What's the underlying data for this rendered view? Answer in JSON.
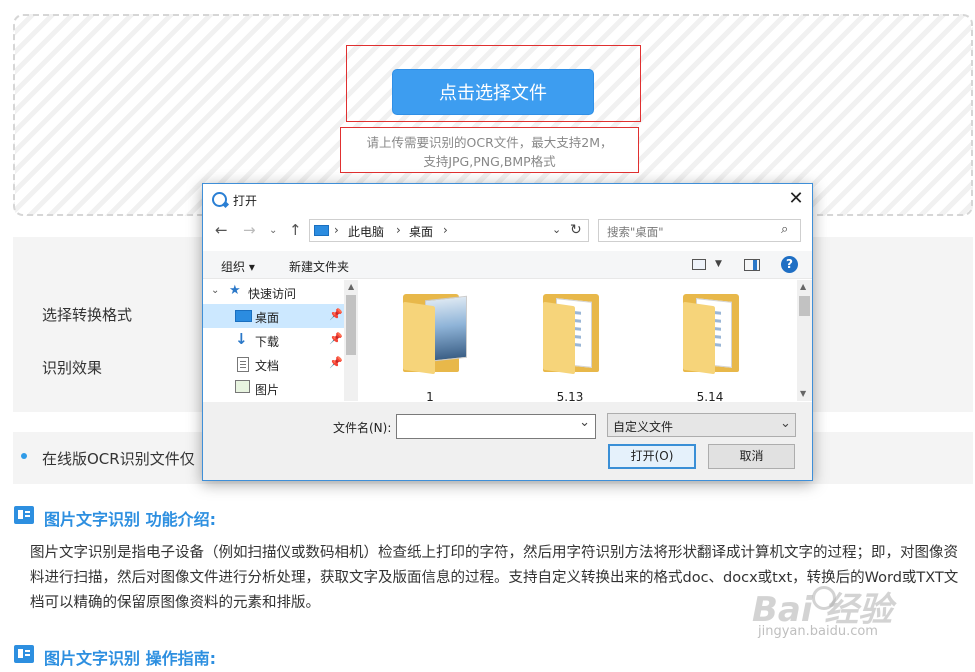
{
  "upload": {
    "button_label": "点击选择文件",
    "hint_line1": "请上传需要识别的OCR文件，最大支持2M，",
    "hint_line2": "支持JPG,PNG,BMP格式"
  },
  "options": {
    "format_label": "选择转换格式",
    "effect_label": "识别效果"
  },
  "notice": {
    "text": "在线版OCR识别文件仅"
  },
  "sections": [
    {
      "title": "图片文字识别 功能介绍:",
      "body": "图片文字识别是指电子设备（例如扫描仪或数码相机）检查纸上打印的字符，然后用字符识别方法将形状翻译成计算机文字的过程；即，对图像资料进行扫描，然后对图像文件进行分析处理，获取文字及版面信息的过程。支持自定义转换出来的格式doc、docx或txt，转换后的Word或TXT文档可以精确的保留原图像资料的元素和排版。"
    },
    {
      "title": "图片文字识别 操作指南:"
    }
  ],
  "watermark": {
    "brand": "Bai  经验",
    "url": "jingyan.baidu.com"
  },
  "dialog": {
    "title": "打开",
    "close": "✕",
    "address": [
      "此电脑",
      "桌面"
    ],
    "search_placeholder": "搜索\"桌面\"",
    "toolbar": {
      "organize": "组织 ▾",
      "new_folder": "新建文件夹",
      "help": "?"
    },
    "nav_tree": [
      {
        "label": "快速访问",
        "icon": "star-icon"
      },
      {
        "label": "桌面",
        "icon": "desktop-icon",
        "selected": true
      },
      {
        "label": "下载",
        "icon": "download-icon"
      },
      {
        "label": "文档",
        "icon": "document-icon"
      },
      {
        "label": "图片",
        "icon": "picture-icon"
      }
    ],
    "files": [
      {
        "name": "1"
      },
      {
        "name": "5.13"
      },
      {
        "name": "5.14"
      }
    ],
    "filename_label": "文件名(N):",
    "filename_value": "",
    "filetype_value": "自定义文件",
    "open_label": "打开(O)",
    "cancel_label": "取消"
  },
  "colors": {
    "accent_blue": "#3d9df0",
    "highlight_red": "#e03030",
    "section_blue": "#2d8fe0"
  }
}
